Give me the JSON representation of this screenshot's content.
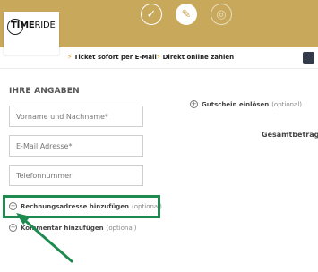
{
  "header": {
    "logo": {
      "part1": "TIME",
      "part2": "RIDE"
    },
    "steps": [
      {
        "name": "step-completed",
        "icon": "checkmark-icon",
        "glyph": "✓"
      },
      {
        "name": "step-current",
        "icon": "edit-icon",
        "glyph": "✎"
      },
      {
        "name": "step-next",
        "icon": "eye-icon",
        "glyph": "◎"
      }
    ],
    "colors": {
      "gold": "#c8a85a"
    }
  },
  "benefits": {
    "item1": "Ticket sofort per E-Mail",
    "item2": "Direkt online zahlen"
  },
  "form": {
    "title": "IHRE ANGABEN",
    "name_placeholder": "Vorname und Nachname*",
    "email_placeholder": "E-Mail Adresse*",
    "phone_placeholder": "Telefonnummer"
  },
  "links": {
    "billing_label": "Rechnungsadresse hinzufügen",
    "billing_optional": "(optional)",
    "comment_label": "Kommentar hinzufügen",
    "comment_optional": "(optional)",
    "voucher_label": "Gutschein einlösen",
    "voucher_optional": "(optional)"
  },
  "summary": {
    "total_label": "Gesamtbetrag:"
  },
  "annotation": {
    "highlight_color": "#1f8a50"
  }
}
